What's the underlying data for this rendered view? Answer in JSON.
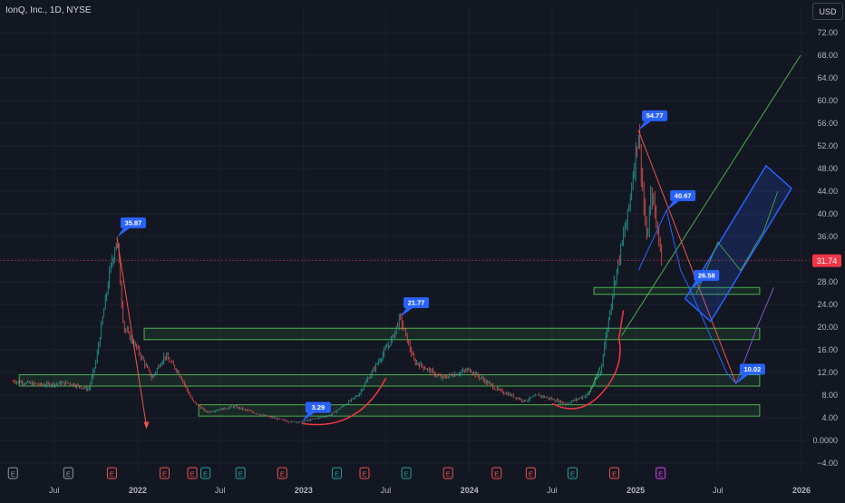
{
  "header": {
    "symbol_title": "IonQ, Inc., 1D, NYSE",
    "currency": "USD"
  },
  "colors": {
    "background": "#131722",
    "grid": "#1e222d",
    "up": "#26a69a",
    "down": "#ef5350",
    "label": "#2962ff",
    "zone": "#4caf50",
    "last_price": "#f23645",
    "channel": "#2962ff",
    "trend": "#4caf50",
    "projection": "#7e57c2"
  },
  "chart_data": {
    "type": "candlestick",
    "y_axis": {
      "min": -4,
      "max": 72,
      "ticks": [
        "72.00",
        "68.00",
        "64.00",
        "60.00",
        "56.00",
        "52.00",
        "48.00",
        "44.00",
        "40.00",
        "36.00",
        "32.00",
        "28.00",
        "24.00",
        "20.00",
        "16.00",
        "12.00",
        "8.00",
        "4.00",
        "0.0000",
        "−4.00"
      ]
    },
    "x_axis": {
      "ticks": [
        {
          "label": "Jul",
          "date": "2021-07-01"
        },
        {
          "label": "2022",
          "date": "2022-01-01"
        },
        {
          "label": "Jul",
          "date": "2022-07-01"
        },
        {
          "label": "2023",
          "date": "2023-01-01"
        },
        {
          "label": "Jul",
          "date": "2023-07-01"
        },
        {
          "label": "2024",
          "date": "2024-01-01"
        },
        {
          "label": "Jul",
          "date": "2024-07-01"
        },
        {
          "label": "2025",
          "date": "2025-01-01"
        },
        {
          "label": "Jul",
          "date": "2025-07-01"
        },
        {
          "label": "2026",
          "date": "2026-01-01"
        }
      ]
    },
    "last_price": {
      "value": 31.74,
      "label": "31.74"
    },
    "price_path": [
      {
        "date": "2021-04-01",
        "value": 10.5
      },
      {
        "date": "2021-06-01",
        "value": 9.8
      },
      {
        "date": "2021-08-01",
        "value": 10.2
      },
      {
        "date": "2021-09-15",
        "value": 9.0
      },
      {
        "date": "2021-10-01",
        "value": 14.0
      },
      {
        "date": "2021-11-01",
        "value": 30.0
      },
      {
        "date": "2021-11-16",
        "value": 35.87
      },
      {
        "date": "2021-12-01",
        "value": 20.0
      },
      {
        "date": "2022-01-01",
        "value": 16.0
      },
      {
        "date": "2022-02-01",
        "value": 11.0
      },
      {
        "date": "2022-03-01",
        "value": 15.0
      },
      {
        "date": "2022-04-01",
        "value": 12.0
      },
      {
        "date": "2022-05-01",
        "value": 7.0
      },
      {
        "date": "2022-06-01",
        "value": 5.0
      },
      {
        "date": "2022-08-01",
        "value": 6.0
      },
      {
        "date": "2022-10-01",
        "value": 4.5
      },
      {
        "date": "2022-12-01",
        "value": 3.3
      },
      {
        "date": "2022-12-28",
        "value": 3.29
      },
      {
        "date": "2023-03-01",
        "value": 4.5
      },
      {
        "date": "2023-05-01",
        "value": 8.0
      },
      {
        "date": "2023-06-15",
        "value": 14.0
      },
      {
        "date": "2023-07-15",
        "value": 18.0
      },
      {
        "date": "2023-08-01",
        "value": 21.77
      },
      {
        "date": "2023-09-01",
        "value": 14.0
      },
      {
        "date": "2023-11-01",
        "value": 11.0
      },
      {
        "date": "2024-01-01",
        "value": 12.5
      },
      {
        "date": "2024-03-01",
        "value": 9.0
      },
      {
        "date": "2024-05-01",
        "value": 7.0
      },
      {
        "date": "2024-06-01",
        "value": 8.0
      },
      {
        "date": "2024-08-01",
        "value": 6.5
      },
      {
        "date": "2024-09-15",
        "value": 8.0
      },
      {
        "date": "2024-10-15",
        "value": 12.0
      },
      {
        "date": "2024-11-15",
        "value": 28.0
      },
      {
        "date": "2024-12-15",
        "value": 40.0
      },
      {
        "date": "2025-01-07",
        "value": 54.77
      },
      {
        "date": "2025-01-25",
        "value": 35.0
      },
      {
        "date": "2025-02-05",
        "value": 44.0
      },
      {
        "date": "2025-02-20",
        "value": 36.0
      },
      {
        "date": "2025-03-01",
        "value": 31.74
      }
    ],
    "annotations": [
      {
        "label": "35.87",
        "date": "2021-11-16",
        "value": 35.87
      },
      {
        "label": "3.29",
        "date": "2022-12-28",
        "value": 3.29
      },
      {
        "label": "21.77",
        "date": "2023-08-01",
        "value": 21.77
      },
      {
        "label": "54.77",
        "date": "2025-01-07",
        "value": 54.77
      },
      {
        "label": "40.67",
        "date": "2025-03-10",
        "value": 40.67
      },
      {
        "label": "26.58",
        "date": "2025-05-01",
        "value": 26.58
      },
      {
        "label": "10.02",
        "date": "2025-08-10",
        "value": 10.02
      }
    ],
    "zones": [
      {
        "name": "support-zone-high",
        "start": "2022-01-15",
        "end": "2025-10-01",
        "low": 17.8,
        "high": 19.8
      },
      {
        "name": "support-zone-mid",
        "start": "2021-04-15",
        "end": "2025-10-01",
        "low": 9.6,
        "high": 11.6
      },
      {
        "name": "support-zone-low",
        "start": "2022-05-15",
        "end": "2025-10-01",
        "low": 4.3,
        "high": 6.3
      },
      {
        "name": "support-zone-top",
        "start": "2024-10-01",
        "end": "2025-10-01",
        "low": 25.8,
        "high": 27.0
      }
    ],
    "events": [
      {
        "type": "E",
        "date": "2021-04-01",
        "style": "neutral"
      },
      {
        "type": "E",
        "date": "2021-08-01",
        "style": "neutral"
      },
      {
        "type": "E",
        "date": "2021-11-05",
        "style": "down"
      },
      {
        "type": "E",
        "date": "2022-03-01",
        "style": "down"
      },
      {
        "type": "E",
        "date": "2022-05-01",
        "style": "down"
      },
      {
        "type": "E",
        "date": "2022-05-30",
        "style": "up"
      },
      {
        "type": "E",
        "date": "2022-08-15",
        "style": "up"
      },
      {
        "type": "E",
        "date": "2022-11-15",
        "style": "down"
      },
      {
        "type": "E",
        "date": "2023-03-15",
        "style": "up"
      },
      {
        "type": "E",
        "date": "2023-05-15",
        "style": "down"
      },
      {
        "type": "E",
        "date": "2023-08-15",
        "style": "up"
      },
      {
        "type": "E",
        "date": "2023-11-15",
        "style": "down"
      },
      {
        "type": "E",
        "date": "2024-03-01",
        "style": "down"
      },
      {
        "type": "E",
        "date": "2024-05-15",
        "style": "down"
      },
      {
        "type": "E",
        "date": "2024-08-15",
        "style": "up"
      },
      {
        "type": "E",
        "date": "2024-11-15",
        "style": "down"
      },
      {
        "type": "E",
        "date": "2025-02-25",
        "style": "future"
      }
    ]
  }
}
